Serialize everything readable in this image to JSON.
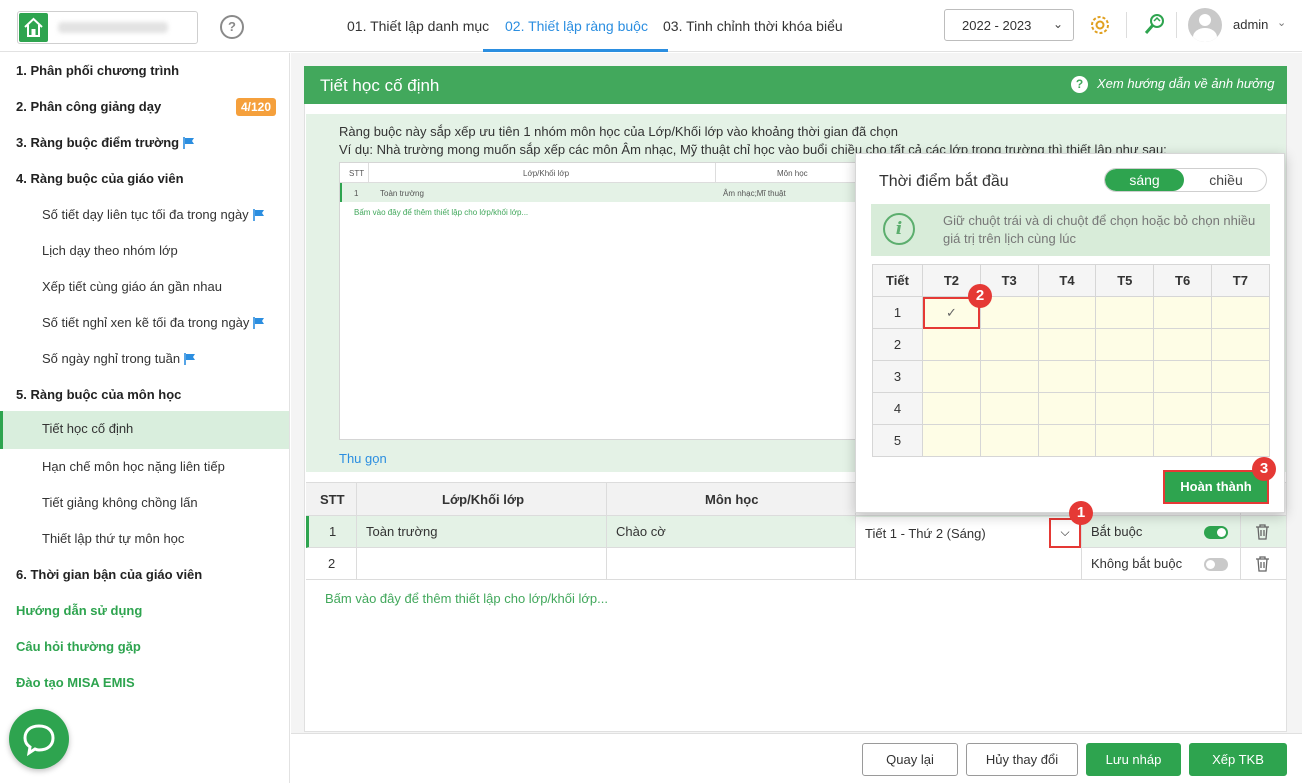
{
  "header": {
    "steps": [
      "01. Thiết lập danh mục",
      "02. Thiết lập ràng buộc",
      "03. Tinh chỉnh thời khóa biểu"
    ],
    "active_step": 1,
    "help_symbol": "?",
    "year": "2022 - 2023",
    "username": "admin",
    "icons": [
      "home-icon",
      "help-icon",
      "gear-icon",
      "wrench-icon",
      "avatar-icon"
    ]
  },
  "sidebar": {
    "items": [
      {
        "label": "1. Phân phối chương trình",
        "level": "main"
      },
      {
        "label": "2. Phân công giảng dạy",
        "level": "main",
        "badge": "4/120"
      },
      {
        "label": "3. Ràng buộc điểm trường",
        "level": "main",
        "flag": true
      },
      {
        "label": "4. Ràng buộc của giáo viên",
        "level": "main"
      },
      {
        "label": "Số tiết dạy liên tục tối đa trong ngày",
        "level": "sub",
        "flag": true
      },
      {
        "label": "Lịch dạy theo nhóm lớp",
        "level": "sub"
      },
      {
        "label": "Xếp tiết cùng giáo án gần nhau",
        "level": "sub"
      },
      {
        "label": "Số tiết nghỉ xen kẽ tối đa trong ngày",
        "level": "sub",
        "flag": true
      },
      {
        "label": "Số ngày nghỉ trong tuần",
        "level": "sub",
        "flag": true
      },
      {
        "label": "5. Ràng buộc của môn học",
        "level": "main"
      },
      {
        "label": "Tiết học cố định",
        "level": "sub",
        "active": true
      },
      {
        "label": "Hạn chế môn học nặng liên tiếp",
        "level": "sub"
      },
      {
        "label": "Tiết giảng không chồng lấn",
        "level": "sub"
      },
      {
        "label": "Thiết lập thứ tự môn học",
        "level": "sub"
      },
      {
        "label": "6. Thời gian bận của giáo viên",
        "level": "main"
      },
      {
        "label": "Hướng dẫn sử dụng",
        "level": "link"
      },
      {
        "label": "Câu hỏi thường gặp",
        "level": "link"
      },
      {
        "label": "Đào tạo MISA EMIS",
        "level": "link"
      }
    ],
    "flag_color": "#2b8ee0",
    "badge_color": "#f5a03c"
  },
  "panel": {
    "title": "Tiết học cố định",
    "help_link": "Xem hướng dẫn về ảnh hưởng",
    "note_line1": "Ràng buộc này sắp xếp ưu tiên 1 nhóm môn học của Lớp/Khối lớp vào khoảng thời gian đã chọn",
    "note_line2": "Ví dụ: Nhà trường mong muốn sắp xếp các môn Âm nhạc, Mỹ thuật chỉ học vào buổi chiều cho tất cả các lớp trong trường thì thiết lập như sau:",
    "preview": {
      "headers": [
        "STT",
        "Lớp/Khối lớp",
        "Môn học"
      ],
      "row": [
        "1",
        "Toàn trường",
        "Âm nhạc;Mĩ thuật"
      ],
      "add_hint": "Bấm vào đây để thêm thiết lập cho lớp/khối lớp..."
    },
    "collapse_label": "Thu gọn"
  },
  "table": {
    "headers": {
      "stt": "STT",
      "class": "Lớp/Khối lớp",
      "subject": "Môn học"
    },
    "rows": [
      {
        "stt": "1",
        "class": "Toàn trường",
        "subject": "Chào cờ",
        "time": "Tiết 1 - Thứ 2 (Sáng)",
        "required_label": "Bắt buộc",
        "required": true
      },
      {
        "stt": "2",
        "class": "",
        "subject": "",
        "time": "",
        "required_label": "Không bắt buộc",
        "required": false
      }
    ],
    "add_link": "Bấm vào đây để thêm thiết lập cho lớp/khối lớp..."
  },
  "popup": {
    "title": "Thời điểm bắt đầu",
    "segment_on": "sáng",
    "segment_off": "chiều",
    "info": "Giữ chuột trái và di chuột để chọn hoặc bỏ chọn nhiều giá trị trên lịch cùng lúc",
    "col_header": "Tiết",
    "days": [
      "T2",
      "T3",
      "T4",
      "T5",
      "T6",
      "T7"
    ],
    "periods": [
      "1",
      "2",
      "3",
      "4",
      "5"
    ],
    "selected": {
      "period": "1",
      "day": "T2"
    },
    "check": "✓",
    "done_label": "Hoàn thành"
  },
  "callouts": [
    "1",
    "2",
    "3"
  ],
  "footer": {
    "back": "Quay lại",
    "cancel": "Hủy thay đổi",
    "save_draft": "Lưu nháp",
    "schedule": "Xếp TKB"
  },
  "colors": {
    "primary_green": "#2ea44f",
    "header_green": "#42a85c",
    "accent_blue": "#2b8ee0",
    "callout_red": "#e53935"
  }
}
